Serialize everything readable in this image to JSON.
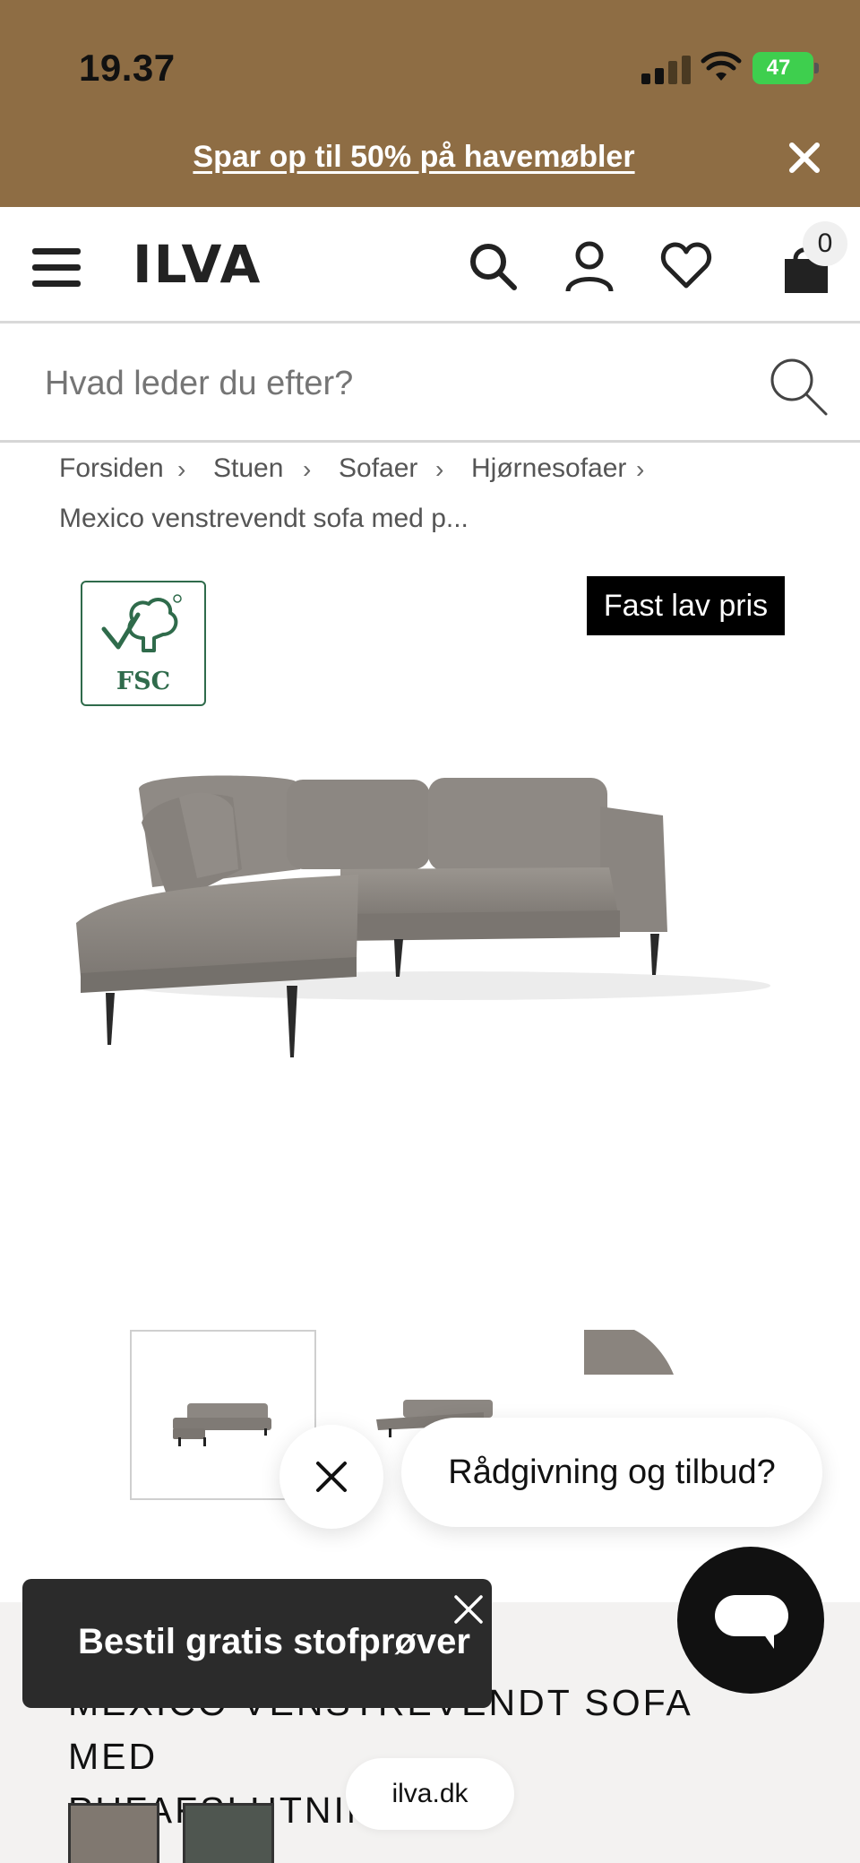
{
  "status_bar": {
    "time": "19.37",
    "battery": "47"
  },
  "promo": {
    "text": "Spar op til 50% på havemøbler"
  },
  "header": {
    "logo": "ILVA",
    "cart_count": "0"
  },
  "search": {
    "placeholder": "Hvad leder du efter?"
  },
  "breadcrumb": {
    "items": [
      "Forsiden",
      "Stuen",
      "Sofaer",
      "Hjørnesofaer"
    ],
    "current": "Mexico venstrevendt sofa med p..."
  },
  "product": {
    "fsc_label": "FSC",
    "price_badge": "Fast lav pris",
    "title_line1": "MEXICO VENSTREVENDT SOFA MED",
    "title_line2": "PUFAFSLUTNING",
    "swatches": [
      "#807870",
      "#4f5650"
    ]
  },
  "chat": {
    "prompt": "Rådgivning og tilbud?"
  },
  "fabric_toast": {
    "text": "Bestil gratis stofprøver"
  },
  "browser": {
    "url": "ilva.dk"
  },
  "colors": {
    "banner": "#8e6d44",
    "sofa": "#8a8580",
    "dark": "#111111"
  }
}
